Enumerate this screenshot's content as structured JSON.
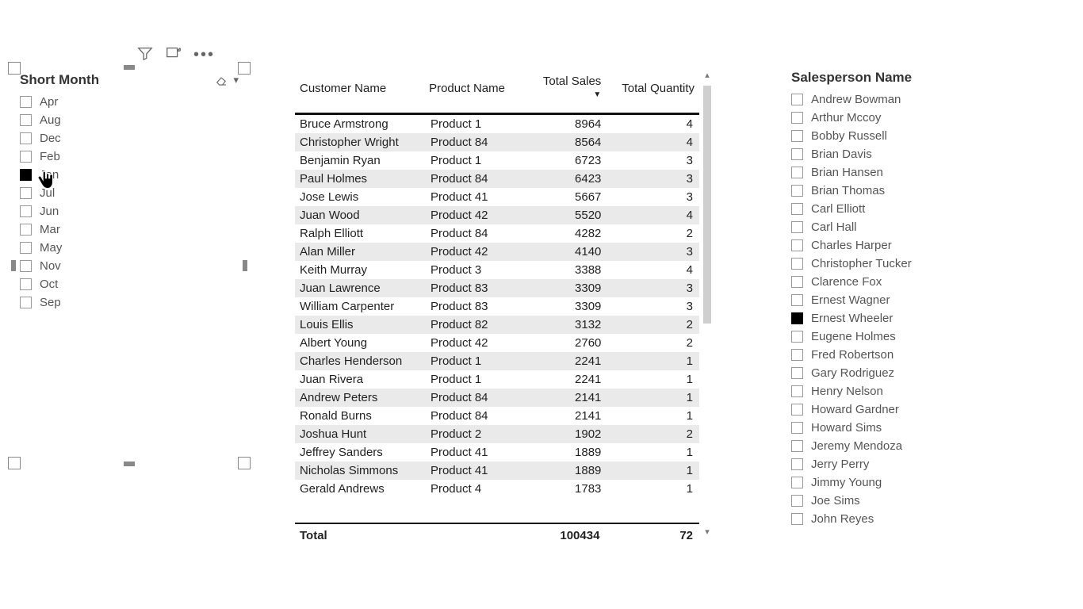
{
  "month_slicer": {
    "title": "Short Month",
    "items": [
      {
        "label": "Apr",
        "checked": false
      },
      {
        "label": "Aug",
        "checked": false
      },
      {
        "label": "Dec",
        "checked": false
      },
      {
        "label": "Feb",
        "checked": false
      },
      {
        "label": "Jan",
        "checked": true
      },
      {
        "label": "Jul",
        "checked": false
      },
      {
        "label": "Jun",
        "checked": false
      },
      {
        "label": "Mar",
        "checked": false
      },
      {
        "label": "May",
        "checked": false
      },
      {
        "label": "Nov",
        "checked": false
      },
      {
        "label": "Oct",
        "checked": false
      },
      {
        "label": "Sep",
        "checked": false
      }
    ]
  },
  "salesperson_slicer": {
    "title": "Salesperson Name",
    "items": [
      {
        "label": "Andrew Bowman",
        "checked": false
      },
      {
        "label": "Arthur Mccoy",
        "checked": false
      },
      {
        "label": "Bobby Russell",
        "checked": false
      },
      {
        "label": "Brian Davis",
        "checked": false
      },
      {
        "label": "Brian Hansen",
        "checked": false
      },
      {
        "label": "Brian Thomas",
        "checked": false
      },
      {
        "label": "Carl Elliott",
        "checked": false
      },
      {
        "label": "Carl Hall",
        "checked": false
      },
      {
        "label": "Charles Harper",
        "checked": false
      },
      {
        "label": "Christopher Tucker",
        "checked": false
      },
      {
        "label": "Clarence Fox",
        "checked": false
      },
      {
        "label": "Ernest Wagner",
        "checked": false
      },
      {
        "label": "Ernest Wheeler",
        "checked": true
      },
      {
        "label": "Eugene Holmes",
        "checked": false
      },
      {
        "label": "Fred Robertson",
        "checked": false
      },
      {
        "label": "Gary Rodriguez",
        "checked": false
      },
      {
        "label": "Henry Nelson",
        "checked": false
      },
      {
        "label": "Howard Gardner",
        "checked": false
      },
      {
        "label": "Howard Sims",
        "checked": false
      },
      {
        "label": "Jeremy Mendoza",
        "checked": false
      },
      {
        "label": "Jerry Perry",
        "checked": false
      },
      {
        "label": "Jimmy Young",
        "checked": false
      },
      {
        "label": "Joe Sims",
        "checked": false
      },
      {
        "label": "John Reyes",
        "checked": false
      }
    ]
  },
  "table": {
    "columns": [
      "Customer Name",
      "Product Name",
      "Total Sales",
      "Total Quantity"
    ],
    "sort_col_index": 2,
    "rows": [
      {
        "customer": "Bruce Armstrong",
        "product": "Product 1",
        "sales": "8964",
        "qty": "4"
      },
      {
        "customer": "Christopher Wright",
        "product": "Product 84",
        "sales": "8564",
        "qty": "4"
      },
      {
        "customer": "Benjamin Ryan",
        "product": "Product 1",
        "sales": "6723",
        "qty": "3"
      },
      {
        "customer": "Paul Holmes",
        "product": "Product 84",
        "sales": "6423",
        "qty": "3"
      },
      {
        "customer": "Jose Lewis",
        "product": "Product 41",
        "sales": "5667",
        "qty": "3"
      },
      {
        "customer": "Juan Wood",
        "product": "Product 42",
        "sales": "5520",
        "qty": "4"
      },
      {
        "customer": "Ralph Elliott",
        "product": "Product 84",
        "sales": "4282",
        "qty": "2"
      },
      {
        "customer": "Alan Miller",
        "product": "Product 42",
        "sales": "4140",
        "qty": "3"
      },
      {
        "customer": "Keith Murray",
        "product": "Product 3",
        "sales": "3388",
        "qty": "4"
      },
      {
        "customer": "Juan Lawrence",
        "product": "Product 83",
        "sales": "3309",
        "qty": "3"
      },
      {
        "customer": "William Carpenter",
        "product": "Product 83",
        "sales": "3309",
        "qty": "3"
      },
      {
        "customer": "Louis Ellis",
        "product": "Product 82",
        "sales": "3132",
        "qty": "2"
      },
      {
        "customer": "Albert Young",
        "product": "Product 42",
        "sales": "2760",
        "qty": "2"
      },
      {
        "customer": "Charles Henderson",
        "product": "Product 1",
        "sales": "2241",
        "qty": "1"
      },
      {
        "customer": "Juan Rivera",
        "product": "Product 1",
        "sales": "2241",
        "qty": "1"
      },
      {
        "customer": "Andrew Peters",
        "product": "Product 84",
        "sales": "2141",
        "qty": "1"
      },
      {
        "customer": "Ronald Burns",
        "product": "Product 84",
        "sales": "2141",
        "qty": "1"
      },
      {
        "customer": "Joshua Hunt",
        "product": "Product 2",
        "sales": "1902",
        "qty": "2"
      },
      {
        "customer": "Jeffrey Sanders",
        "product": "Product 41",
        "sales": "1889",
        "qty": "1"
      },
      {
        "customer": "Nicholas Simmons",
        "product": "Product 41",
        "sales": "1889",
        "qty": "1"
      },
      {
        "customer": "Gerald Andrews",
        "product": "Product 4",
        "sales": "1783",
        "qty": "1"
      }
    ],
    "total_label": "Total",
    "total_sales": "100434",
    "total_qty": "72"
  }
}
